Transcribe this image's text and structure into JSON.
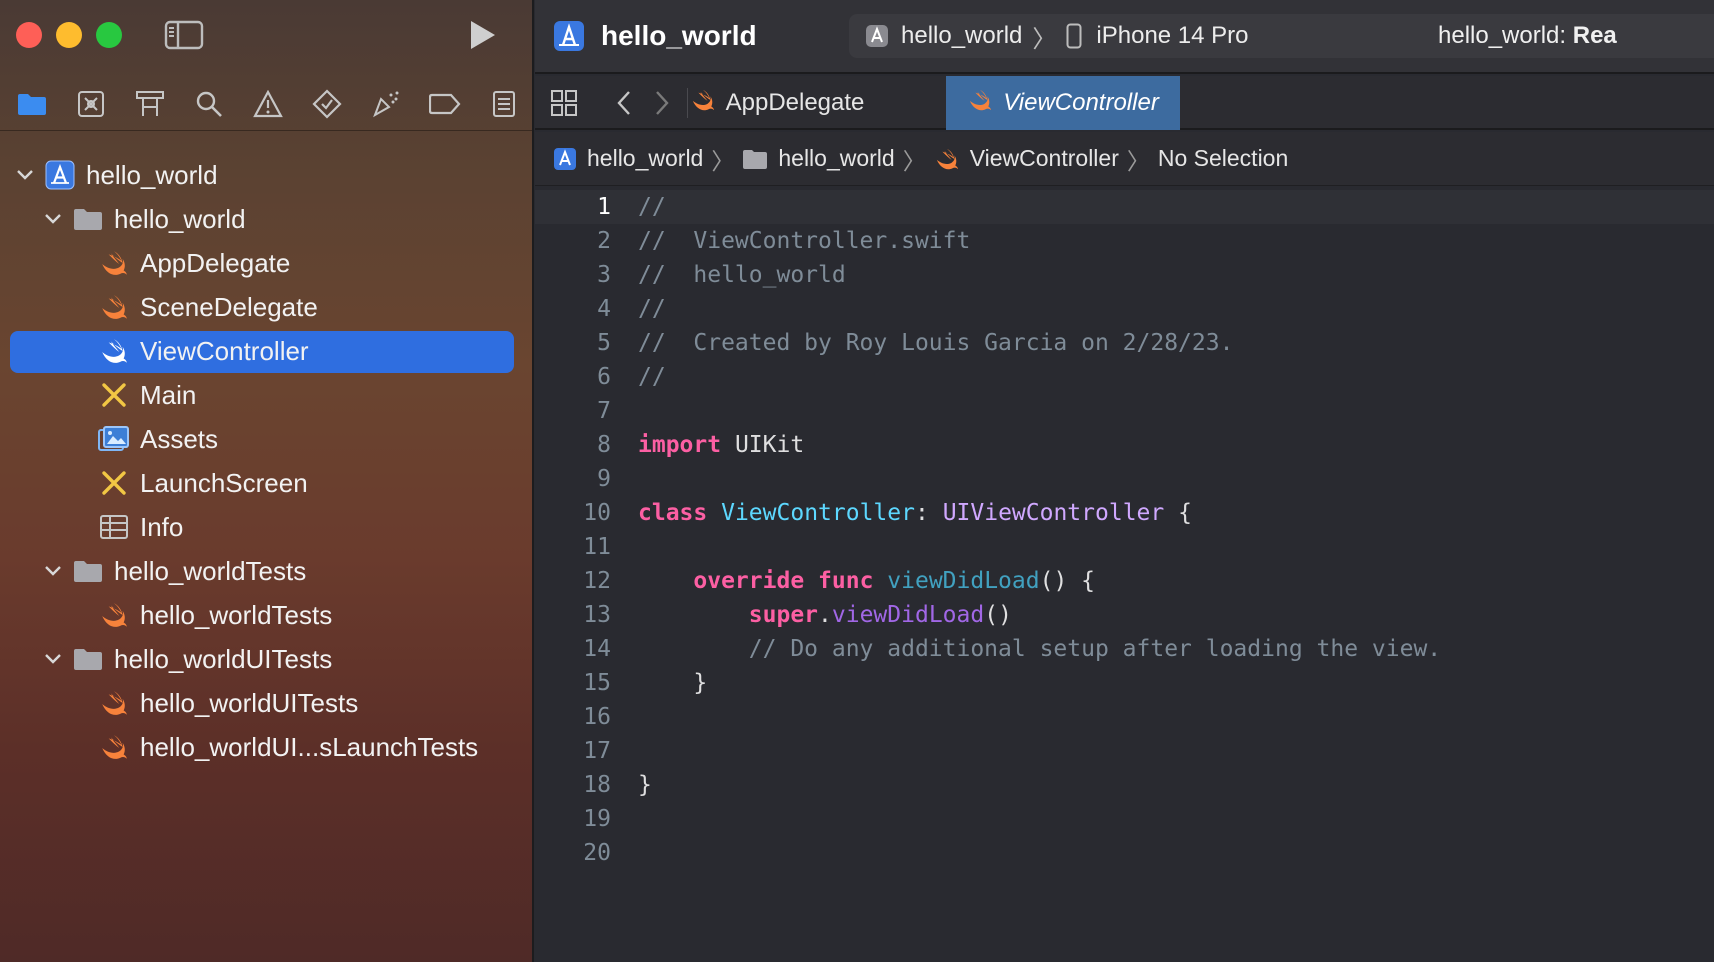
{
  "colors": {
    "close": "#fe5f57",
    "minimize": "#febc2e",
    "zoom": "#28c840",
    "selection": "#2f6ee0",
    "active_tab": "#3d6b9f",
    "swift": "#f7823b",
    "folder": "#a8a8ad"
  },
  "toolbar": {
    "sidebar_toggle_icon": "sidebar-left-icon",
    "run_icon": "play-icon",
    "project_title": "hello_world",
    "scheme": {
      "target": "hello_world",
      "device": "iPhone 14 Pro"
    },
    "status_prefix": "hello_world: ",
    "status_state": "Rea"
  },
  "navigator_tabs": [
    "folder-icon",
    "source-control-icon",
    "symbol-icon",
    "find-icon",
    "issue-icon",
    "test-icon",
    "debug-icon",
    "breakpoint-icon",
    "report-icon"
  ],
  "tree": [
    {
      "label": "hello_world",
      "level": 0,
      "icon": "xcode-project-icon",
      "expanded": true
    },
    {
      "label": "hello_world",
      "level": 1,
      "icon": "folder-icon",
      "expanded": true
    },
    {
      "label": "AppDelegate",
      "level": 2,
      "icon": "swift-icon"
    },
    {
      "label": "SceneDelegate",
      "level": 2,
      "icon": "swift-icon"
    },
    {
      "label": "ViewController",
      "level": 2,
      "icon": "swift-icon",
      "selected": true
    },
    {
      "label": "Main",
      "level": 2,
      "icon": "storyboard-icon"
    },
    {
      "label": "Assets",
      "level": 2,
      "icon": "assets-icon"
    },
    {
      "label": "LaunchScreen",
      "level": 2,
      "icon": "storyboard-icon"
    },
    {
      "label": "Info",
      "level": 2,
      "icon": "plist-icon"
    },
    {
      "label": "hello_worldTests",
      "level": 1,
      "icon": "folder-icon",
      "expanded": true
    },
    {
      "label": "hello_worldTests",
      "level": 2,
      "icon": "swift-icon"
    },
    {
      "label": "hello_worldUITests",
      "level": 1,
      "icon": "folder-icon",
      "expanded": true
    },
    {
      "label": "hello_worldUITests",
      "level": 2,
      "icon": "swift-icon"
    },
    {
      "label": "hello_worldUI...sLaunchTests",
      "level": 2,
      "icon": "swift-icon"
    }
  ],
  "tabs": [
    {
      "label": "AppDelegate",
      "active": false
    },
    {
      "label": "ViewController",
      "active": true
    }
  ],
  "breadcrumb": [
    "hello_world",
    "hello_world",
    "ViewController",
    "No Selection"
  ],
  "code": {
    "current_line": 1,
    "lines": [
      [
        [
          "c-com",
          "//"
        ]
      ],
      [
        [
          "c-com",
          "//  ViewController.swift"
        ]
      ],
      [
        [
          "c-com",
          "//  hello_world"
        ]
      ],
      [
        [
          "c-com",
          "//"
        ]
      ],
      [
        [
          "c-com",
          "//  Created by Roy Louis Garcia on 2/28/23."
        ]
      ],
      [
        [
          "c-com",
          "//"
        ]
      ],
      [],
      [
        [
          "c-kw",
          "import"
        ],
        [
          "",
          " UIKit"
        ]
      ],
      [],
      [
        [
          "c-kw",
          "class"
        ],
        [
          "",
          " "
        ],
        [
          "c-type",
          "ViewController"
        ],
        [
          "",
          ": "
        ],
        [
          "c-sup",
          "UIViewController"
        ],
        [
          "",
          " {"
        ]
      ],
      [],
      [
        [
          "",
          "    "
        ],
        [
          "c-kw",
          "override"
        ],
        [
          "",
          " "
        ],
        [
          "c-kw",
          "func"
        ],
        [
          "",
          " "
        ],
        [
          "c-fn",
          "viewDidLoad"
        ],
        [
          "",
          "() {"
        ]
      ],
      [
        [
          "",
          "        "
        ],
        [
          "c-kw",
          "super"
        ],
        [
          "",
          "."
        ],
        [
          "c-call",
          "viewDidLoad"
        ],
        [
          "",
          "()"
        ]
      ],
      [
        [
          "",
          "        "
        ],
        [
          "c-com",
          "// Do any additional setup after loading the view."
        ]
      ],
      [
        [
          "",
          "    }"
        ]
      ],
      [],
      [],
      [
        [
          "",
          "}"
        ]
      ],
      [],
      []
    ]
  }
}
